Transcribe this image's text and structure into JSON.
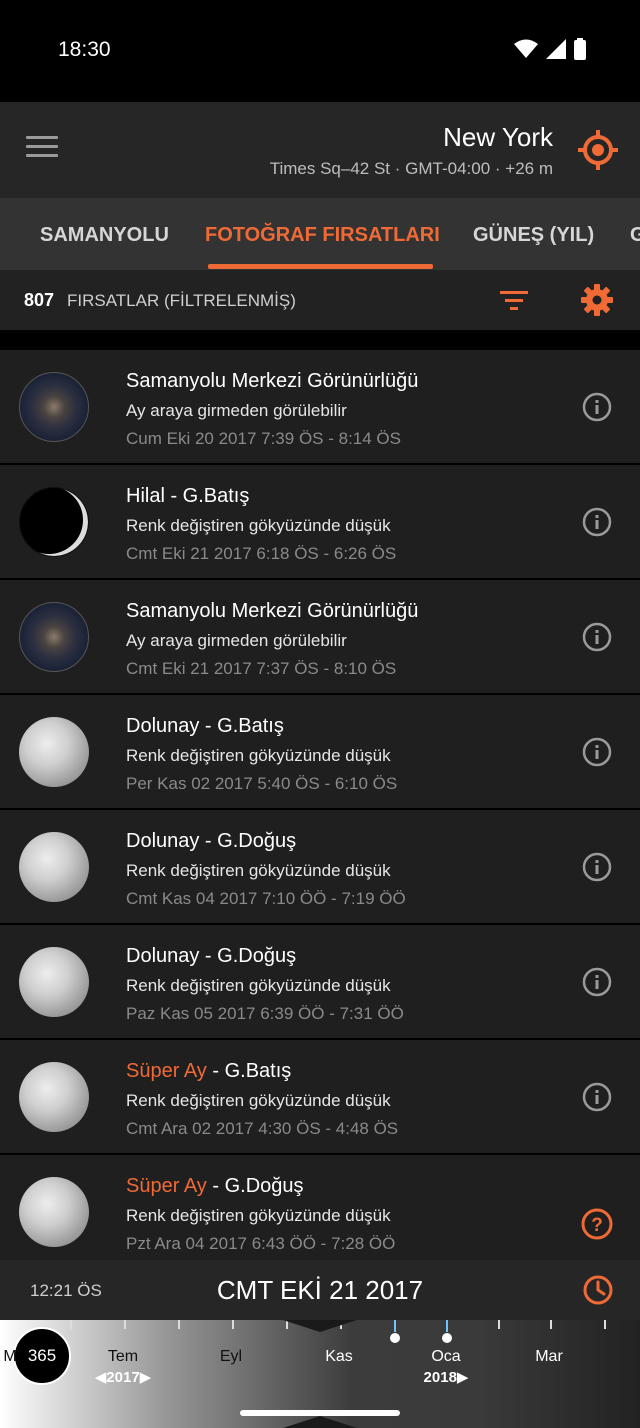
{
  "status": {
    "time": "18:30"
  },
  "header": {
    "city": "New York",
    "subtitle": "Times Sq–42 St  ·  GMT-04:00  ·  +26 m"
  },
  "tabs": [
    {
      "label": "SAMANYOLU"
    },
    {
      "label": "FOTOĞRAF FIRSATLARI",
      "active": true
    },
    {
      "label": "GÜNEŞ (YIL)"
    },
    {
      "label": "G"
    }
  ],
  "filter": {
    "count": "807",
    "label": "FIRSATLAR (FİLTRELENMİŞ)"
  },
  "items": [
    {
      "icon": "milky-way",
      "title": "Samanyolu Merkezi Görünürlüğü",
      "title_accent": "",
      "subtitle": "Ay araya girmeden görülebilir",
      "time": "Cum Eki 20 2017 7:39 ÖS - 8:14 ÖS"
    },
    {
      "icon": "crescent-moon",
      "title": "Hilal - G.Batış",
      "title_accent": "",
      "subtitle": "Renk değiştiren gökyüzünde düşük",
      "time": "Cmt Eki 21 2017 6:18 ÖS - 6:26 ÖS"
    },
    {
      "icon": "milky-way",
      "title": "Samanyolu Merkezi Görünürlüğü",
      "title_accent": "",
      "subtitle": "Ay araya girmeden görülebilir",
      "time": "Cmt Eki 21 2017 7:37 ÖS - 8:10 ÖS"
    },
    {
      "icon": "full-moon",
      "title": "Dolunay - G.Batış",
      "title_accent": "",
      "subtitle": "Renk değiştiren gökyüzünde düşük",
      "time": "Per Kas 02 2017 5:40 ÖS - 6:10 ÖS"
    },
    {
      "icon": "full-moon",
      "title": "Dolunay - G.Doğuş",
      "title_accent": "",
      "subtitle": "Renk değiştiren gökyüzünde düşük",
      "time": "Cmt Kas 04 2017 7:10 ÖÖ - 7:19 ÖÖ"
    },
    {
      "icon": "full-moon",
      "title": "Dolunay - G.Doğuş",
      "title_accent": "",
      "subtitle": "Renk değiştiren gökyüzünde düşük",
      "time": "Paz Kas 05 2017 6:39 ÖÖ - 7:31 ÖÖ"
    },
    {
      "icon": "full-moon",
      "title": " - G.Batış",
      "title_accent": "Süper Ay",
      "subtitle": "Renk değiştiren gökyüzünde düşük",
      "time": "Cmt Ara 02 2017 4:30 ÖS - 4:48 ÖS"
    },
    {
      "icon": "full-moon",
      "title": " - G.Doğuş",
      "title_accent": "Süper Ay",
      "subtitle": "Renk değiştiren gökyüzünde düşük",
      "time": "Pzt Ara 04 2017 6:43 ÖÖ - 7:28 ÖÖ"
    }
  ],
  "date_bar": {
    "time": "12:21 ÖS",
    "date": "CMT EKİ 21 2017"
  },
  "timeline": {
    "days_label": "365",
    "months": [
      {
        "label": "M"
      },
      {
        "label": "Tem",
        "year": "◀2017▶"
      },
      {
        "label": "Eyl"
      },
      {
        "label": "Kas"
      },
      {
        "label": "Oca",
        "year": "2018▶"
      },
      {
        "label": "Mar"
      }
    ]
  },
  "colors": {
    "accent": "#f06a35",
    "header_bg": "#262626",
    "tabs_bg": "#333333",
    "item_bg": "#1f1f1f"
  }
}
